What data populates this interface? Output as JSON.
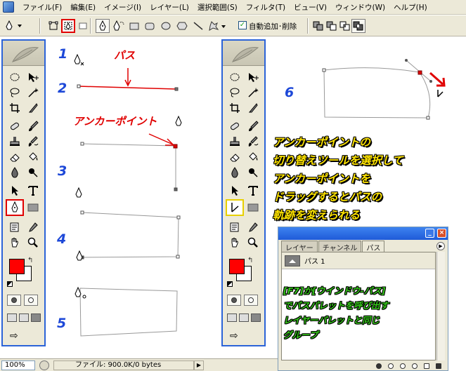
{
  "menu": {
    "items": [
      "ファイル(F)",
      "編集(E)",
      "イメージ(I)",
      "レイヤー(L)",
      "選択範囲(S)",
      "フィルタ(T)",
      "ビュー(V)",
      "ウィンドウ(W)",
      "ヘルプ(H)"
    ]
  },
  "options_bar": {
    "auto_add_delete_label": "自動追加･削除",
    "auto_add_delete_checked": true
  },
  "steps": [
    "1",
    "2",
    "3",
    "4",
    "5",
    "6"
  ],
  "labels": {
    "path": "パス",
    "anchor_point": "アンカーポイント"
  },
  "caption": {
    "lines": [
      "アンカーポイントの",
      "切り替えツールを選択して",
      "アンカーポイントを",
      "ドラッグするとパスの",
      "軌跡を変えられる"
    ]
  },
  "palette": {
    "tabs": [
      "レイヤー",
      "チャンネル",
      "パス"
    ],
    "active_tab": "パス",
    "rows": [
      "パス 1"
    ],
    "note": [
      "[F7]か[ウインドウ-パス]",
      "でパスパレットを呼び出す",
      "レイヤーパレットと同じ",
      "グループ"
    ]
  },
  "status": {
    "zoom": "100%",
    "info": "ファイル: 900.0K/0 bytes"
  },
  "colors": {
    "foreground": "#ff0000",
    "background": "#ffffff",
    "highlight_red": "#e00000",
    "step_blue": "#1d48d8",
    "caption_yellow": "#ffe400",
    "note_green": "#35c81a"
  }
}
